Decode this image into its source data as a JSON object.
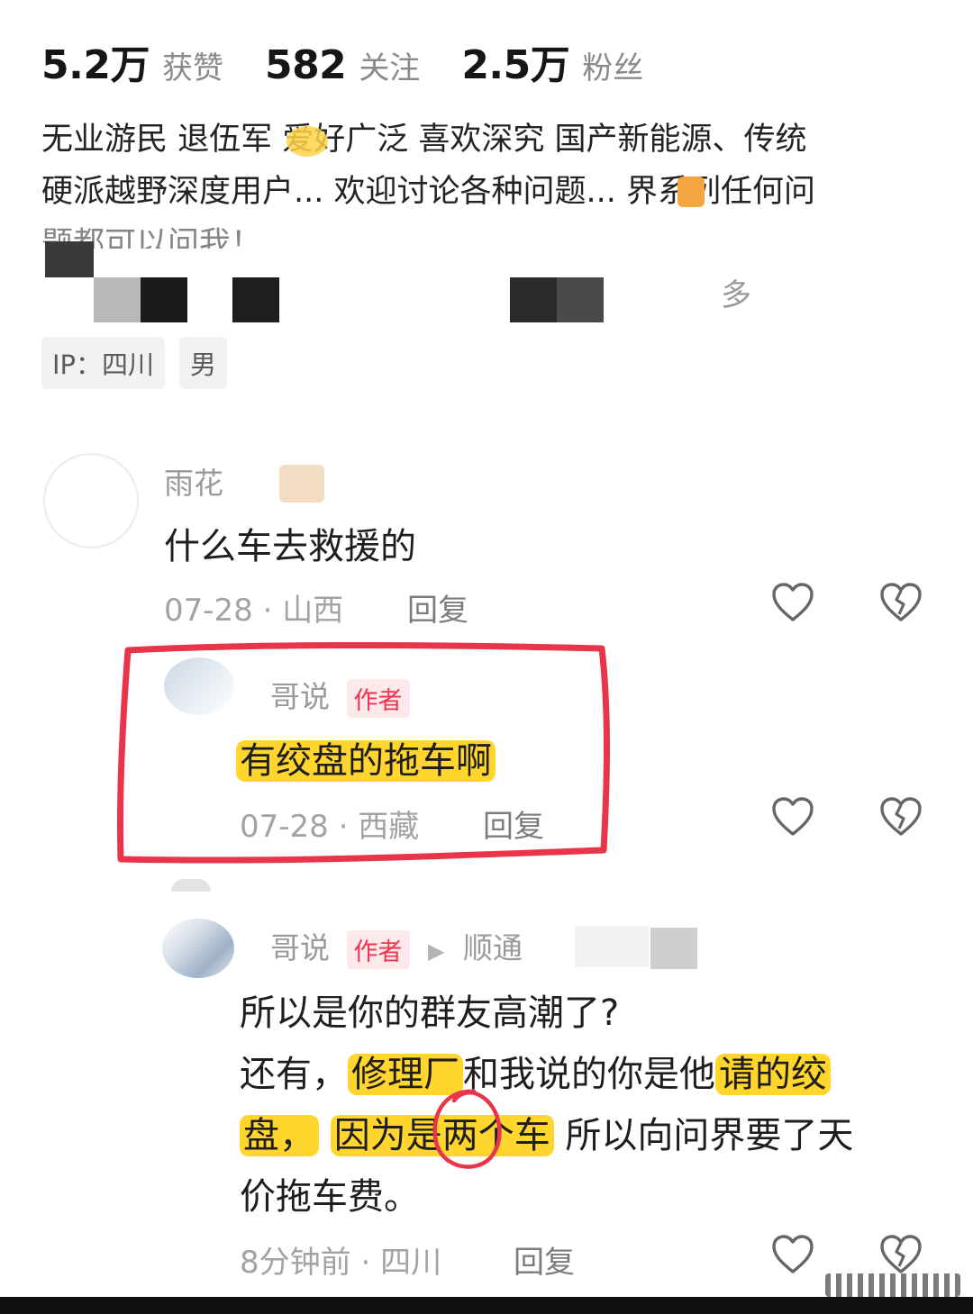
{
  "profile": {
    "stats": [
      {
        "value": "5.2万",
        "label": "获赞"
      },
      {
        "value": "582",
        "label": "关注"
      },
      {
        "value": "2.5万",
        "label": "粉丝"
      }
    ],
    "bio_lines": [
      "无业游民 退伍军 爱好广泛 喜欢深究 国产新能源、传统",
      "硬派越野深度用户... 欢迎讨论各种问题... 界系列任何问",
      "题都可以问我！"
    ],
    "more_label": "多",
    "tags": [
      "IP：四川",
      "男"
    ]
  },
  "comments": [
    {
      "username": "雨花",
      "text": "什么车去救援的",
      "date": "07-28",
      "location": "山西",
      "reply_label": "回复"
    },
    {
      "username": "哥说",
      "badge": "作者",
      "text": "有绞盘的拖车啊",
      "date": "07-28",
      "location": "西藏",
      "reply_label": "回复"
    },
    {
      "username": "哥说",
      "badge": "作者",
      "reply_to": "顺通",
      "lines": [
        "所以是你的群友高潮了?",
        "还有，修理厂和我说的你是他请的绞",
        "盘，因为是两个车 所以向问界要了天",
        "价拖车费。"
      ],
      "time": "8分钟前",
      "location": "四川",
      "reply_label": "回复"
    }
  ],
  "colors": {
    "annotation_red": "#e8354a",
    "highlight_yellow": "#ffcc00",
    "author_badge": "#f2324f"
  },
  "icons": [
    "heart-icon",
    "broken-heart-icon",
    "play-arrow-icon"
  ]
}
